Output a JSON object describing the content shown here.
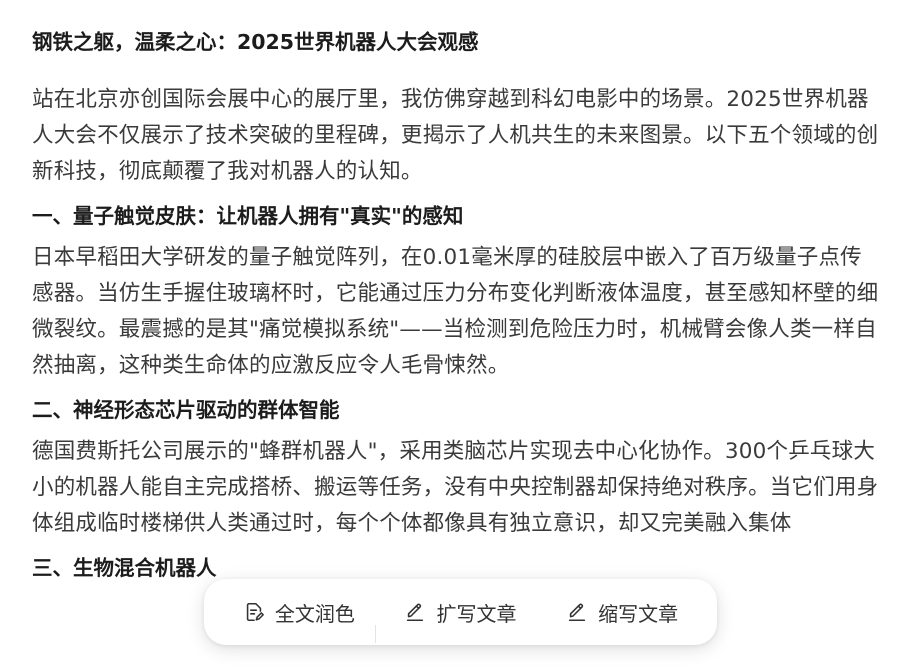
{
  "article": {
    "title": "钢铁之躯，温柔之心：2025世界机器人大会观感",
    "intro": "站在北京亦创国际会展中心的展厅里，我仿佛穿越到科幻电影中的场景。2025世界机器人大会不仅展示了技术突破的里程碑，更揭示了人机共生的未来图景。以下五个领域的创新科技，彻底颠覆了我对机器人的认知。",
    "sections": [
      {
        "heading": "一、量子触觉皮肤：让机器人拥有\"真实\"的感知",
        "body": "日本早稻田大学研发的量子触觉阵列，在0.01毫米厚的硅胶层中嵌入了百万级量子点传感器。当仿生手握住玻璃杯时，它能通过压力分布变化判断液体温度，甚至感知杯壁的细微裂纹。最震撼的是其\"痛觉模拟系统\"——当检测到危险压力时，机械臂会像人类一样自然抽离，这种类生命体的应激反应令人毛骨悚然。"
      },
      {
        "heading": "二、神经形态芯片驱动的群体智能",
        "body": "德国费斯托公司展示的\"蜂群机器人\"，采用类脑芯片实现去中心化协作。300个乒乓球大小的机器人能自主完成搭桥、搬运等任务，没有中央控制器却保持绝对秩序。当它们用身体组成临时楼梯供人类通过时，每个个体都像具有独立意识，却又完美融入集体"
      },
      {
        "heading": "三、生物混合机器人"
      }
    ]
  },
  "toolbar": {
    "polish_label": "全文润色",
    "expand_label": "扩写文章",
    "shorten_label": "缩写文章"
  },
  "icons": {
    "polish": "document-edit-icon",
    "expand": "pen-icon",
    "shorten": "pen-icon"
  }
}
